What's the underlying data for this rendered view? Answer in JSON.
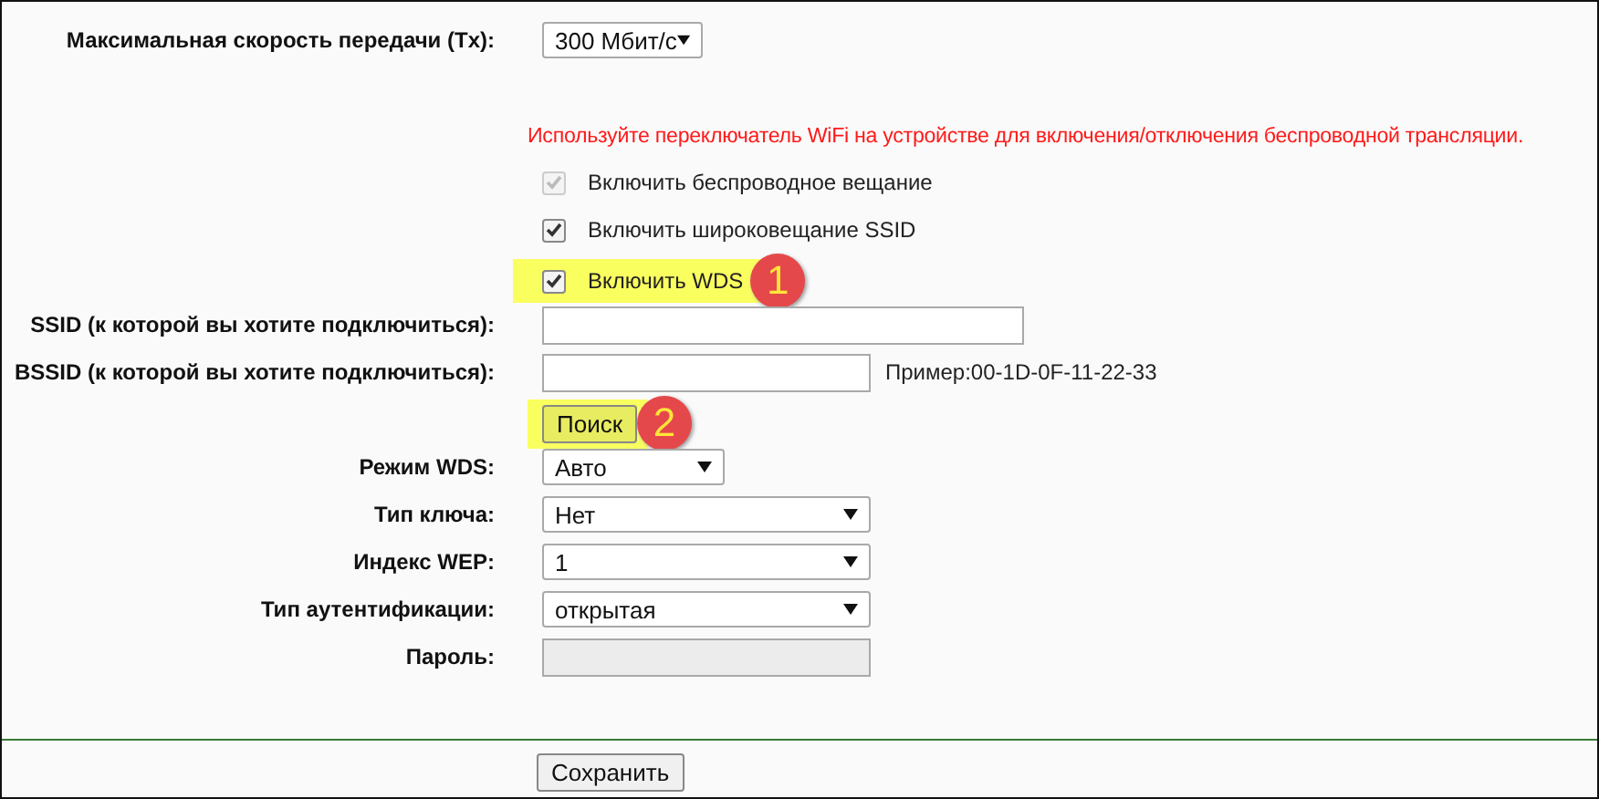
{
  "speed": {
    "label": "Максимальная скорость передачи (Tx):",
    "value": "300 Мбит/с"
  },
  "notice": "Используйте переключатель WiFi на устройстве для включения/отключения беспроводной трансляции.",
  "checkboxes": [
    {
      "label": "Включить беспроводное вещание",
      "checked": true,
      "disabled": true,
      "highlighted": false
    },
    {
      "label": "Включить широковещание SSID",
      "checked": true,
      "disabled": false,
      "highlighted": false
    },
    {
      "label": "Включить WDS",
      "checked": true,
      "disabled": false,
      "highlighted": true,
      "badge": "1"
    }
  ],
  "fields": [
    {
      "kind": "wide_text",
      "label": "SSID (к которой вы хотите подключиться):"
    },
    {
      "kind": "text",
      "label": "BSSID (к которой вы хотите подключиться):",
      "hint": "Пример:00-1D-0F-11-22-33"
    },
    {
      "kind": "button",
      "text": "Поиск",
      "highlighted": true,
      "badge": "2"
    },
    {
      "kind": "short_select",
      "label": "Режим WDS:",
      "value": "Авто"
    },
    {
      "kind": "select",
      "label": "Тип ключа:",
      "value": "Нет"
    },
    {
      "kind": "select",
      "label": "Индекс WEP:",
      "value": "1"
    },
    {
      "kind": "select",
      "label": "Тип аутентификации:",
      "value": "открытая"
    },
    {
      "kind": "password",
      "label": "Пароль:",
      "disabled": true
    }
  ],
  "save_button": "Сохранить"
}
